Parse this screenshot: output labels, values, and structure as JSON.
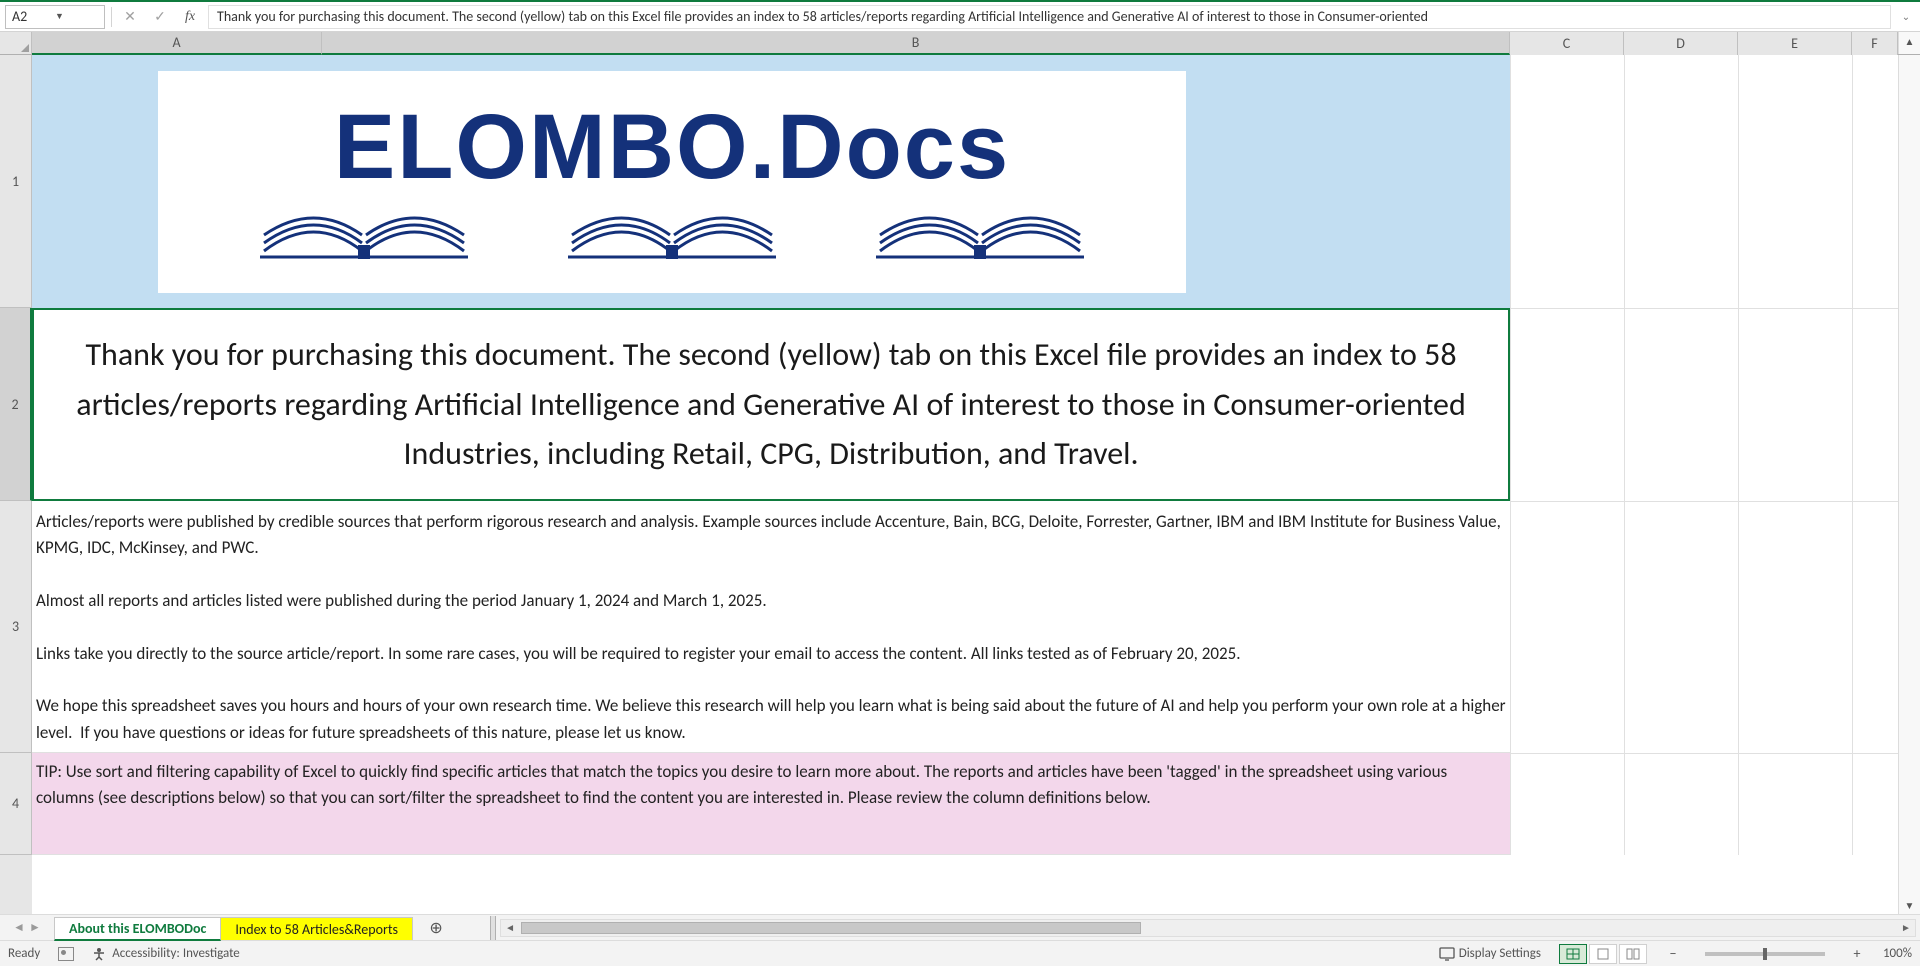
{
  "formula_bar": {
    "cell_ref": "A2",
    "content": "Thank you for purchasing this document. The second (yellow) tab on this Excel file provides an index to 58 articles/reports regarding Artificial Intelligence and Generative AI of interest to those in Consumer-oriented"
  },
  "columns": [
    "A",
    "B",
    "C",
    "D",
    "E",
    "F"
  ],
  "rows": [
    "1",
    "2",
    "3",
    "4"
  ],
  "logo": {
    "brand_text": "ELOMBO.Docs"
  },
  "row2_text": "Thank you for purchasing this document. The second (yellow) tab on this Excel file provides an index to 58 articles/reports regarding Artificial Intelligence and Generative AI of interest to those in Consumer-oriented Industries, including Retail, CPG, Distribution, and Travel.",
  "row3_text": "Articles/reports were published by credible sources that perform rigorous research and analysis. Example sources include Accenture, Bain, BCG, Deloite, Forrester, Gartner, IBM and IBM Institute for Business Value, KPMG, IDC, McKinsey, and PWC.\n\nAlmost all reports and articles listed were published during the period January 1, 2024 and March 1, 2025.\n\nLinks take you directly to the source article/report. In some rare cases, you will be required to register your email to access the content. All links tested as of February 20, 2025.\n\nWe hope this spreadsheet saves you hours and hours of your own research time. We believe this research will help you learn what is being said about the future of AI and help you perform your own role at a higher level.  If you have questions or ideas for future spreadsheets of this nature, please let us know.",
  "row4_text": "TIP: Use sort and filtering capability of Excel to quickly find specific articles that match the topics you desire to learn more about. The reports and articles have been 'tagged' in the spreadsheet using various columns (see descriptions below) so that you can sort/filter the spreadsheet to find the content you are interested in. Please review the column definitions below.",
  "tabs": {
    "active": "About this ELOMBODoc",
    "second": "Index to 58 Articles&Reports"
  },
  "status": {
    "ready": "Ready",
    "accessibility": "Accessibility: Investigate",
    "display_settings": "Display Settings",
    "zoom": "100%"
  }
}
